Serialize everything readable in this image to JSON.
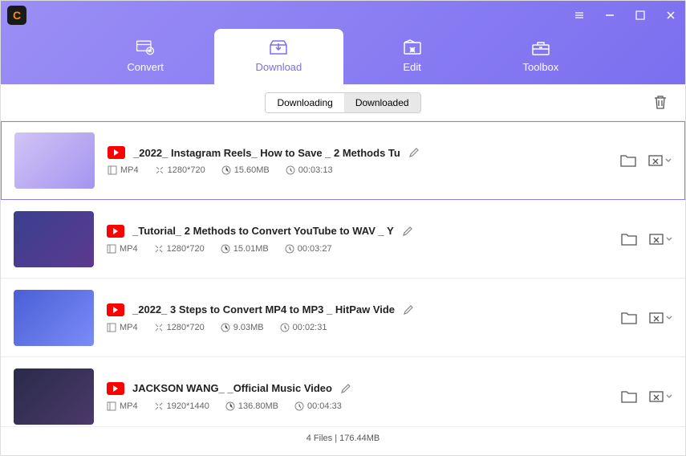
{
  "logo": "C",
  "nav": [
    {
      "label": "Convert",
      "icon": "convert"
    },
    {
      "label": "Download",
      "icon": "download",
      "active": true
    },
    {
      "label": "Edit",
      "icon": "edit"
    },
    {
      "label": "Toolbox",
      "icon": "toolbox"
    }
  ],
  "tabs": {
    "downloading": "Downloading",
    "downloaded": "Downloaded",
    "active": "downloaded"
  },
  "videos": [
    {
      "title": "_2022_ Instagram Reels_ How to Save _ 2 Methods Tu",
      "format": "MP4",
      "resolution": "1280*720",
      "size": "15.60MB",
      "duration": "00:03:13",
      "selected": true
    },
    {
      "title": "_Tutorial_ 2 Methods to Convert YouTube to WAV _ Y",
      "format": "MP4",
      "resolution": "1280*720",
      "size": "15.01MB",
      "duration": "00:03:27"
    },
    {
      "title": "_2022_ 3 Steps to Convert MP4 to MP3 _ HitPaw Vide",
      "format": "MP4",
      "resolution": "1280*720",
      "size": "9.03MB",
      "duration": "00:02:31"
    },
    {
      "title": "JACKSON WANG_ _Official Music Video",
      "format": "MP4",
      "resolution": "1920*1440",
      "size": "136.80MB",
      "duration": "00:04:33"
    }
  ],
  "footer": "4 Files | 176.44MB"
}
